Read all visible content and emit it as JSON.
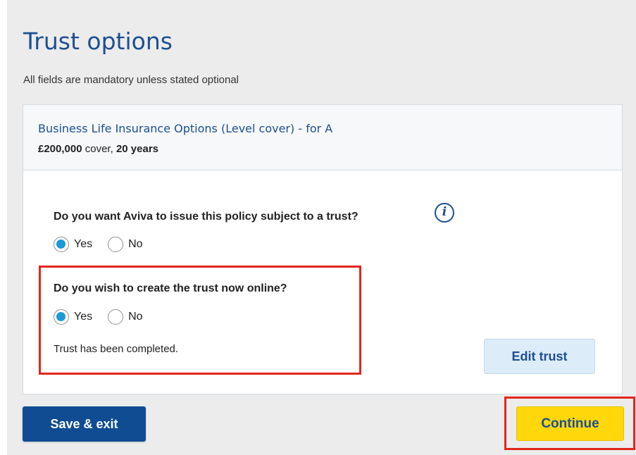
{
  "page": {
    "title": "Trust options",
    "mandatory_note": "All fields are mandatory unless stated optional"
  },
  "policy": {
    "product_name": "Business Life Insurance Options (Level cover) - for A",
    "cover_amount": "£200,000",
    "cover_word": " cover, ",
    "term": "20 years"
  },
  "trust_question": {
    "label": "Do you want Aviva to issue this policy subject to a trust?",
    "info_icon": "i",
    "options": [
      {
        "label": "Yes",
        "selected": true
      },
      {
        "label": "No",
        "selected": false
      }
    ]
  },
  "online_question": {
    "label": "Do you wish to create the trust now online?",
    "options": [
      {
        "label": "Yes",
        "selected": true
      },
      {
        "label": "No",
        "selected": false
      }
    ],
    "status": "Trust has been completed."
  },
  "actions": {
    "edit_trust": "Edit trust",
    "save_exit": "Save & exit",
    "continue": "Continue"
  },
  "colors": {
    "brand_blue": "#1d4f91",
    "radio_selected": "#1b9ad6",
    "continue_yellow": "#ffd70a",
    "highlight_red": "#e2261c"
  },
  "icons": {
    "info": "info-icon"
  }
}
